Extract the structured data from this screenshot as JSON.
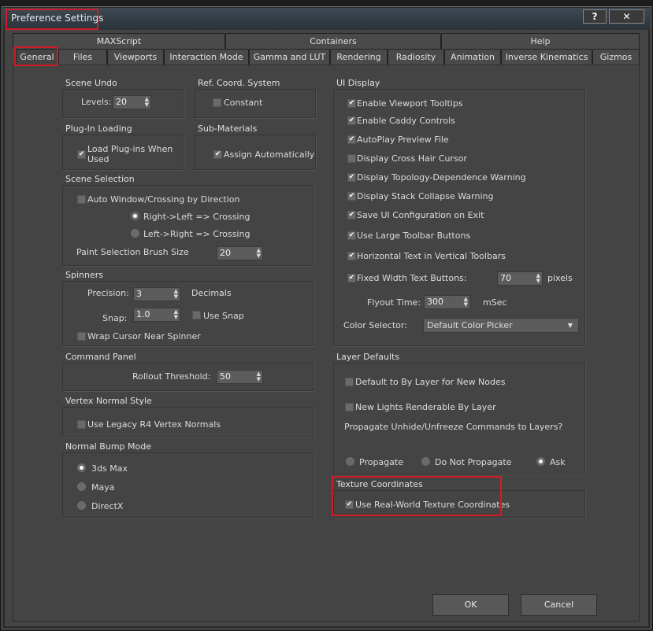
{
  "window": {
    "title": "Preference Settings",
    "help": "?",
    "close": "✕"
  },
  "tabs_row1": [
    "MAXScript",
    "Containers",
    "Help"
  ],
  "tabs_row2": [
    "General",
    "Files",
    "Viewports",
    "Interaction Mode",
    "Gamma and LUT",
    "Rendering",
    "Radiosity",
    "Animation",
    "Inverse Kinematics",
    "Gizmos"
  ],
  "scene_undo": {
    "title": "Scene Undo",
    "levels_label": "Levels:",
    "levels": "20"
  },
  "ref_coord": {
    "title": "Ref. Coord. System",
    "constant": "Constant"
  },
  "plugin": {
    "title": "Plug-In Loading",
    "load1": "Load Plug-ins When",
    "load2": "Used"
  },
  "submat": {
    "title": "Sub-Materials",
    "assign": "Assign Automatically"
  },
  "scene_sel": {
    "title": "Scene Selection",
    "auto": "Auto Window/Crossing by Direction",
    "rl": "Right->Left => Crossing",
    "lr": "Left->Right => Crossing",
    "brush_label": "Paint Selection Brush Size",
    "brush": "20"
  },
  "spinners": {
    "title": "Spinners",
    "precision_label": "Precision:",
    "precision": "3",
    "decimals": "Decimals",
    "snap_label": "Snap:",
    "snap": "1.0",
    "use_snap": "Use Snap",
    "wrap": "Wrap Cursor Near Spinner"
  },
  "cmd_panel": {
    "title": "Command Panel",
    "rollout_label": "Rollout Threshold:",
    "rollout": "50"
  },
  "vns": {
    "title": "Vertex Normal Style",
    "legacy": "Use Legacy R4 Vertex Normals"
  },
  "nbm": {
    "title": "Normal Bump Mode",
    "opts": [
      "3ds Max",
      "Maya",
      "DirectX"
    ]
  },
  "ui": {
    "title": "UI Display",
    "items": [
      "Enable Viewport Tooltips",
      "Enable Caddy Controls",
      "AutoPlay Preview File",
      "Display Cross Hair Cursor",
      "Display Topology-Dependence Warning",
      "Display Stack Collapse Warning",
      "Save UI Configuration on Exit",
      "Use Large Toolbar Buttons",
      "Horizontal Text in Vertical Toolbars",
      "Fixed Width Text Buttons:"
    ],
    "fixed_width": "70",
    "pixels": "pixels",
    "flyout_label": "Flyout Time:",
    "flyout": "300",
    "msec": "mSec",
    "color_label": "Color Selector:",
    "color": "Default Color Picker"
  },
  "layer": {
    "title": "Layer Defaults",
    "bylayer": "Default to By Layer for New Nodes",
    "lights": "New Lights Renderable By Layer",
    "propagate_q": "Propagate Unhide/Unfreeze Commands to Layers?",
    "opts": [
      "Propagate",
      "Do Not Propagate",
      "Ask"
    ]
  },
  "tex": {
    "title": "Texture Coordinates",
    "realworld": "Use Real-World Texture Coordinates"
  },
  "buttons": {
    "ok": "OK",
    "cancel": "Cancel"
  }
}
